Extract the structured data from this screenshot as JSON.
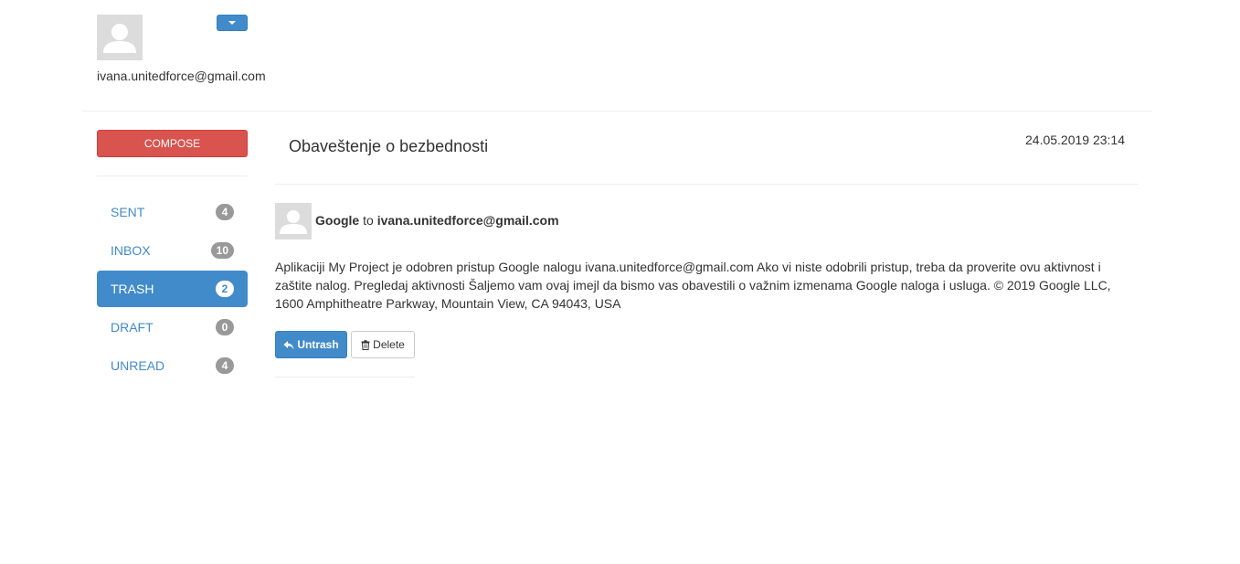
{
  "profile": {
    "email": "ivana.unitedforce@gmail.com",
    "avatar_icon": "user-silhouette-icon",
    "dropdown_icon": "caret-down-icon"
  },
  "sidebar": {
    "compose_label": "COMPOSE",
    "folders": [
      {
        "label": "SENT",
        "count": "4",
        "active": false
      },
      {
        "label": "INBOX",
        "count": "10",
        "active": false
      },
      {
        "label": "TRASH",
        "count": "2",
        "active": true
      },
      {
        "label": "DRAFT",
        "count": "0",
        "active": false
      },
      {
        "label": "UNREAD",
        "count": "4",
        "active": false
      }
    ]
  },
  "message": {
    "subject": "Obaveštenje o bezbednosti",
    "date": "24.05.2019 23:14",
    "sender": "Google",
    "to_word": "to",
    "recipient": "ivana.unitedforce@gmail.com",
    "body": "Aplikaciji My Project je odobren pristup Google nalogu ivana.unitedforce@gmail.com Ako vi niste odobrili pristup, treba da proverite ovu aktivnost i zaštite nalog. Pregledaj aktivnosti Šaljemo vam ovaj imejl da bismo vas obavestili o važnim izmenama Google naloga i usluga. © 2019 Google LLC, 1600 Amphitheatre Parkway, Mountain View, CA 94043, USA"
  },
  "actions": {
    "untrash_label": "Untrash",
    "untrash_icon": "reply-arrow-icon",
    "delete_label": "Delete",
    "delete_icon": "trash-icon"
  },
  "colors": {
    "primary": "#428bca",
    "danger": "#d9534f",
    "badge": "#999999"
  }
}
